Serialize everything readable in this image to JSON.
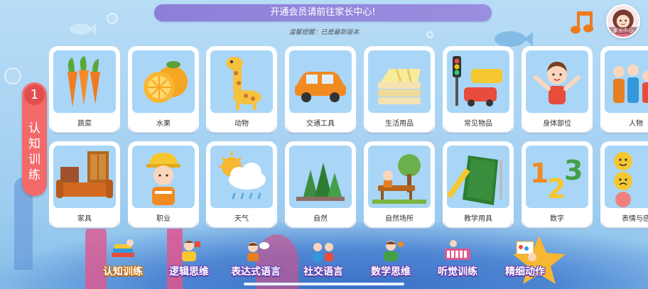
{
  "banner": {
    "text": "开通会员请前往家长中心!"
  },
  "version_text": "温馨提醒：已是最新版本",
  "parent_center": {
    "label": "家长中心"
  },
  "side_tab": {
    "number": "1",
    "title": "认知训练"
  },
  "categories_row1": [
    {
      "label": "蔬菜",
      "icon": "carrot-icon"
    },
    {
      "label": "水果",
      "icon": "orange-icon"
    },
    {
      "label": "动物",
      "icon": "giraffe-icon"
    },
    {
      "label": "交通工具",
      "icon": "car-icon"
    },
    {
      "label": "生活用品",
      "icon": "blanket-icon"
    },
    {
      "label": "常见物品",
      "icon": "traffic-light-icon"
    },
    {
      "label": "身体部位",
      "icon": "child-icon"
    },
    {
      "label": "人物",
      "icon": "family-icon"
    }
  ],
  "categories_row2": [
    {
      "label": "家具",
      "icon": "sofa-icon"
    },
    {
      "label": "职业",
      "icon": "worker-icon"
    },
    {
      "label": "天气",
      "icon": "weather-icon"
    },
    {
      "label": "自然",
      "icon": "trees-icon"
    },
    {
      "label": "自然场所",
      "icon": "park-icon"
    },
    {
      "label": "教学用具",
      "icon": "book-pencil-icon"
    },
    {
      "label": "数字",
      "icon": "numbers-icon"
    },
    {
      "label": "表情与感",
      "icon": "emotion-icon"
    }
  ],
  "bottom_nav": [
    {
      "label": "认知训练",
      "icon": "books-icon"
    },
    {
      "label": "逻辑思维",
      "icon": "puzzle-icon"
    },
    {
      "label": "表达式语言",
      "icon": "speech-icon"
    },
    {
      "label": "社交语言",
      "icon": "friends-icon"
    },
    {
      "label": "数学思维",
      "icon": "math-icon"
    },
    {
      "label": "听觉训练",
      "icon": "piano-icon"
    },
    {
      "label": "精细动作",
      "icon": "paint-icon"
    }
  ],
  "colors": {
    "banner": "#8d7fd8",
    "side_tab": "#f26a6a",
    "music": "#f07a1e",
    "card_bg": "#a9d6f7"
  }
}
